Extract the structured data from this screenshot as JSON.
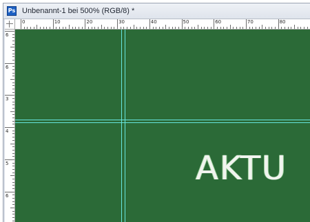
{
  "window": {
    "title": "Unbenannt-1 bei 500% (RGB/8) *",
    "app_icon_text": "Ps"
  },
  "rulers": {
    "horizontal_labels": [
      "0",
      "10",
      "20",
      "30",
      "40",
      "50",
      "60",
      "70",
      "80",
      "9"
    ],
    "vertical_labels": [
      "6",
      "6",
      "3",
      "4",
      "5",
      "6"
    ]
  },
  "canvas": {
    "background_color": "#2b6a37",
    "guide_color": "#67e6df",
    "text": "AKTU"
  }
}
